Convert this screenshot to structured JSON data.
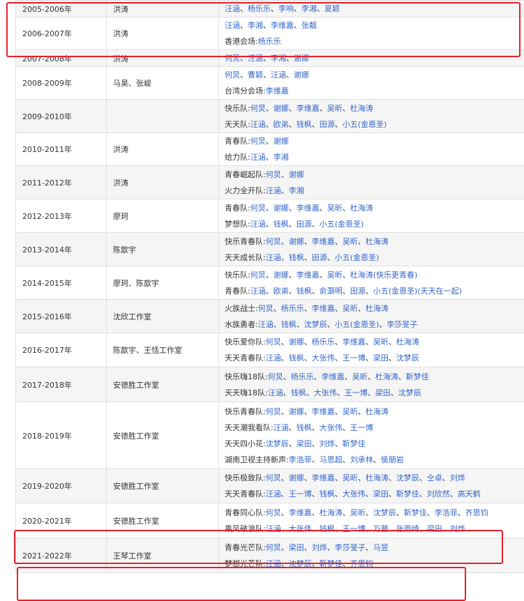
{
  "rows": [
    {
      "year": "2005-2006年",
      "host": "洪涛",
      "lines": [
        {
          "names": [
            "汪涵",
            "杨乐乐",
            "李响",
            "李湘",
            "夏颖"
          ]
        }
      ]
    },
    {
      "year": "2006-2007年",
      "host": "洪涛",
      "lines": [
        {
          "names": [
            "汪涵",
            "李湘",
            "李维嘉",
            "张靓"
          ]
        },
        {
          "prefix": "香港会场:",
          "names": [
            "杨乐乐"
          ]
        }
      ]
    },
    {
      "year": "2007-2008年",
      "host": "洪涛",
      "lines": [
        {
          "names": [
            "何炅",
            "汪涵",
            "李湘",
            "谢娜"
          ]
        }
      ]
    },
    {
      "year": "2008-2009年",
      "host": "马昊、张峻",
      "lines": [
        {
          "names": [
            "何炅",
            "曹颖",
            "汪涵",
            "谢娜"
          ]
        },
        {
          "prefix": "台湾分会场:",
          "names": [
            "李维嘉"
          ]
        }
      ]
    },
    {
      "year": "2009-2010年",
      "host": "",
      "lines": [
        {
          "prefix": "快乐队:",
          "names": [
            "何炅",
            "谢娜",
            "李维嘉",
            "吴昕",
            "杜海涛"
          ]
        },
        {
          "prefix": "天天队:",
          "names": [
            "汪涵",
            "欧弟",
            "钱枫",
            "田源",
            "小五(金恩圣)"
          ]
        }
      ]
    },
    {
      "year": "2010-2011年",
      "host": "洪涛",
      "lines": [
        {
          "prefix": "青春队:",
          "names": [
            "何炅",
            "谢娜"
          ]
        },
        {
          "prefix": "给力队:",
          "names": [
            "汪涵",
            "李湘"
          ]
        }
      ]
    },
    {
      "year": "2011-2012年",
      "host": "洪涛",
      "lines": [
        {
          "prefix": "青春崛起队:",
          "names": [
            "何炅",
            "谢娜"
          ]
        },
        {
          "prefix": "火力全开队:",
          "names": [
            "汪涵",
            "李湘"
          ]
        }
      ]
    },
    {
      "year": "2012-2013年",
      "host": "廖珂",
      "lines": [
        {
          "prefix": "青春队:",
          "names": [
            "何炅",
            "谢娜",
            "李维嘉",
            "吴昕",
            "杜海涛"
          ]
        },
        {
          "prefix": "梦想队:",
          "names": [
            "汪涵",
            "钱枫",
            "田源",
            "小五(金恩圣)"
          ]
        }
      ]
    },
    {
      "year": "2013-2014年",
      "host": "陈歆宇",
      "lines": [
        {
          "prefix": "快乐青春队:",
          "names": [
            "何炅",
            "谢娜",
            "李维嘉",
            "吴昕",
            "杜海涛"
          ]
        },
        {
          "prefix": "天天成长队:",
          "names": [
            "汪涵",
            "钱枫",
            "田源",
            "小五(金恩圣)"
          ]
        }
      ]
    },
    {
      "year": "2014-2015年",
      "host": "廖珂、陈歆宇",
      "lines": [
        {
          "prefix": "快乐队:",
          "names": [
            "何炅",
            "谢娜",
            "李维嘉",
            "吴昕",
            "杜海涛(快乐更青春)"
          ]
        },
        {
          "prefix": "青春队:",
          "names": [
            "汪涵",
            "欧弟",
            "钱枫",
            "俞灏明",
            "田源",
            "小五(金恩圣)(天天在一起)"
          ]
        }
      ]
    },
    {
      "year": "2015-2016年",
      "host": "沈欣工作室",
      "lines": [
        {
          "prefix": "火族战士:",
          "names": [
            "何炅",
            "杨乐乐",
            "李维嘉",
            "吴昕",
            "杜海涛"
          ]
        },
        {
          "prefix": "水族勇者:",
          "names": [
            "汪涵",
            "钱枫",
            "沈梦辰",
            "小五(金恩圣)",
            "李莎旻子"
          ]
        }
      ]
    },
    {
      "year": "2016-2017年",
      "host": "陈歆宇、王恬工作室",
      "lines": [
        {
          "prefix": "快乐爱你队:",
          "names": [
            "何炅",
            "谢娜",
            "杨乐乐",
            "李维嘉",
            "吴昕",
            "杜海涛"
          ]
        },
        {
          "prefix": "天天青春队:",
          "names": [
            "汪涵",
            "钱枫",
            "大张伟",
            "王一博",
            "梁田",
            "沈梦辰"
          ]
        }
      ]
    },
    {
      "year": "2017-2018年",
      "host": "安德胜工作室",
      "lines": [
        {
          "prefix": "快乐嗨18队:",
          "names": [
            "何炅",
            "杨乐乐",
            "李维嘉",
            "吴昕",
            "杜海涛",
            "靳梦佳"
          ]
        },
        {
          "prefix": "天天嗨18队:",
          "names": [
            "汪涵",
            "钱枫",
            "大张伟",
            "王一博",
            "梁田",
            "沈梦辰"
          ]
        }
      ]
    },
    {
      "year": "2018-2019年",
      "host": "安德胜工作室",
      "lines": [
        {
          "prefix": "快乐青春队:",
          "names": [
            "何炅",
            "谢娜",
            "李维嘉",
            "吴昕",
            "杜海涛"
          ]
        },
        {
          "prefix": "天天潮我看队:",
          "names": [
            "汪涵",
            "钱枫",
            "大张伟",
            "王一博"
          ]
        },
        {
          "prefix": "天天四小花:",
          "names": [
            "沈梦辰",
            "梁田",
            "刘烨",
            "靳梦佳"
          ]
        },
        {
          "prefix": "湖南卫视主持新声:",
          "names": [
            "李浩菲",
            "马思超",
            "刘承林",
            "侯朋岩"
          ]
        }
      ]
    },
    {
      "year": "2019-2020年",
      "host": "安德胜工作室",
      "lines": [
        {
          "prefix": "快乐极致队:",
          "names": [
            "何炅",
            "谢娜",
            "李维嘉",
            "吴昕",
            "杜海涛",
            "沈梦辰",
            "仝卓",
            "刘烨"
          ]
        },
        {
          "prefix": "天天青春队:",
          "names": [
            "汪涵",
            "王一博",
            "钱枫",
            "大张伟",
            "梁田",
            "靳梦佳",
            "刘欣然",
            "高天鹤"
          ]
        }
      ]
    },
    {
      "year": "2020-2021年",
      "host": "安德胜工作室",
      "lines": [
        {
          "prefix": "青春同心队:",
          "names": [
            "何炅",
            "李维嘉",
            "杜海涛",
            "吴昕",
            "沈梦辰",
            "靳梦佳",
            "李浩菲",
            "齐思钧"
          ]
        },
        {
          "prefix": "乘风破浪队:",
          "names": [
            "汪涵",
            "大张伟",
            "钱枫",
            "王一博",
            "万茜",
            "张雨绮",
            "梁田",
            "刘烨"
          ]
        }
      ]
    },
    {
      "year": "2021-2022年",
      "host": "王琴工作室",
      "lines": [
        {
          "prefix": "青春光芒队:",
          "names": [
            "何炅",
            "梁田",
            "刘烨",
            "李莎旻子",
            "马昱"
          ]
        },
        {
          "prefix": "梦想光芒队:",
          "names": [
            "汪涵",
            "沈梦辰",
            "靳梦佳",
            "齐思钧"
          ]
        }
      ]
    }
  ]
}
